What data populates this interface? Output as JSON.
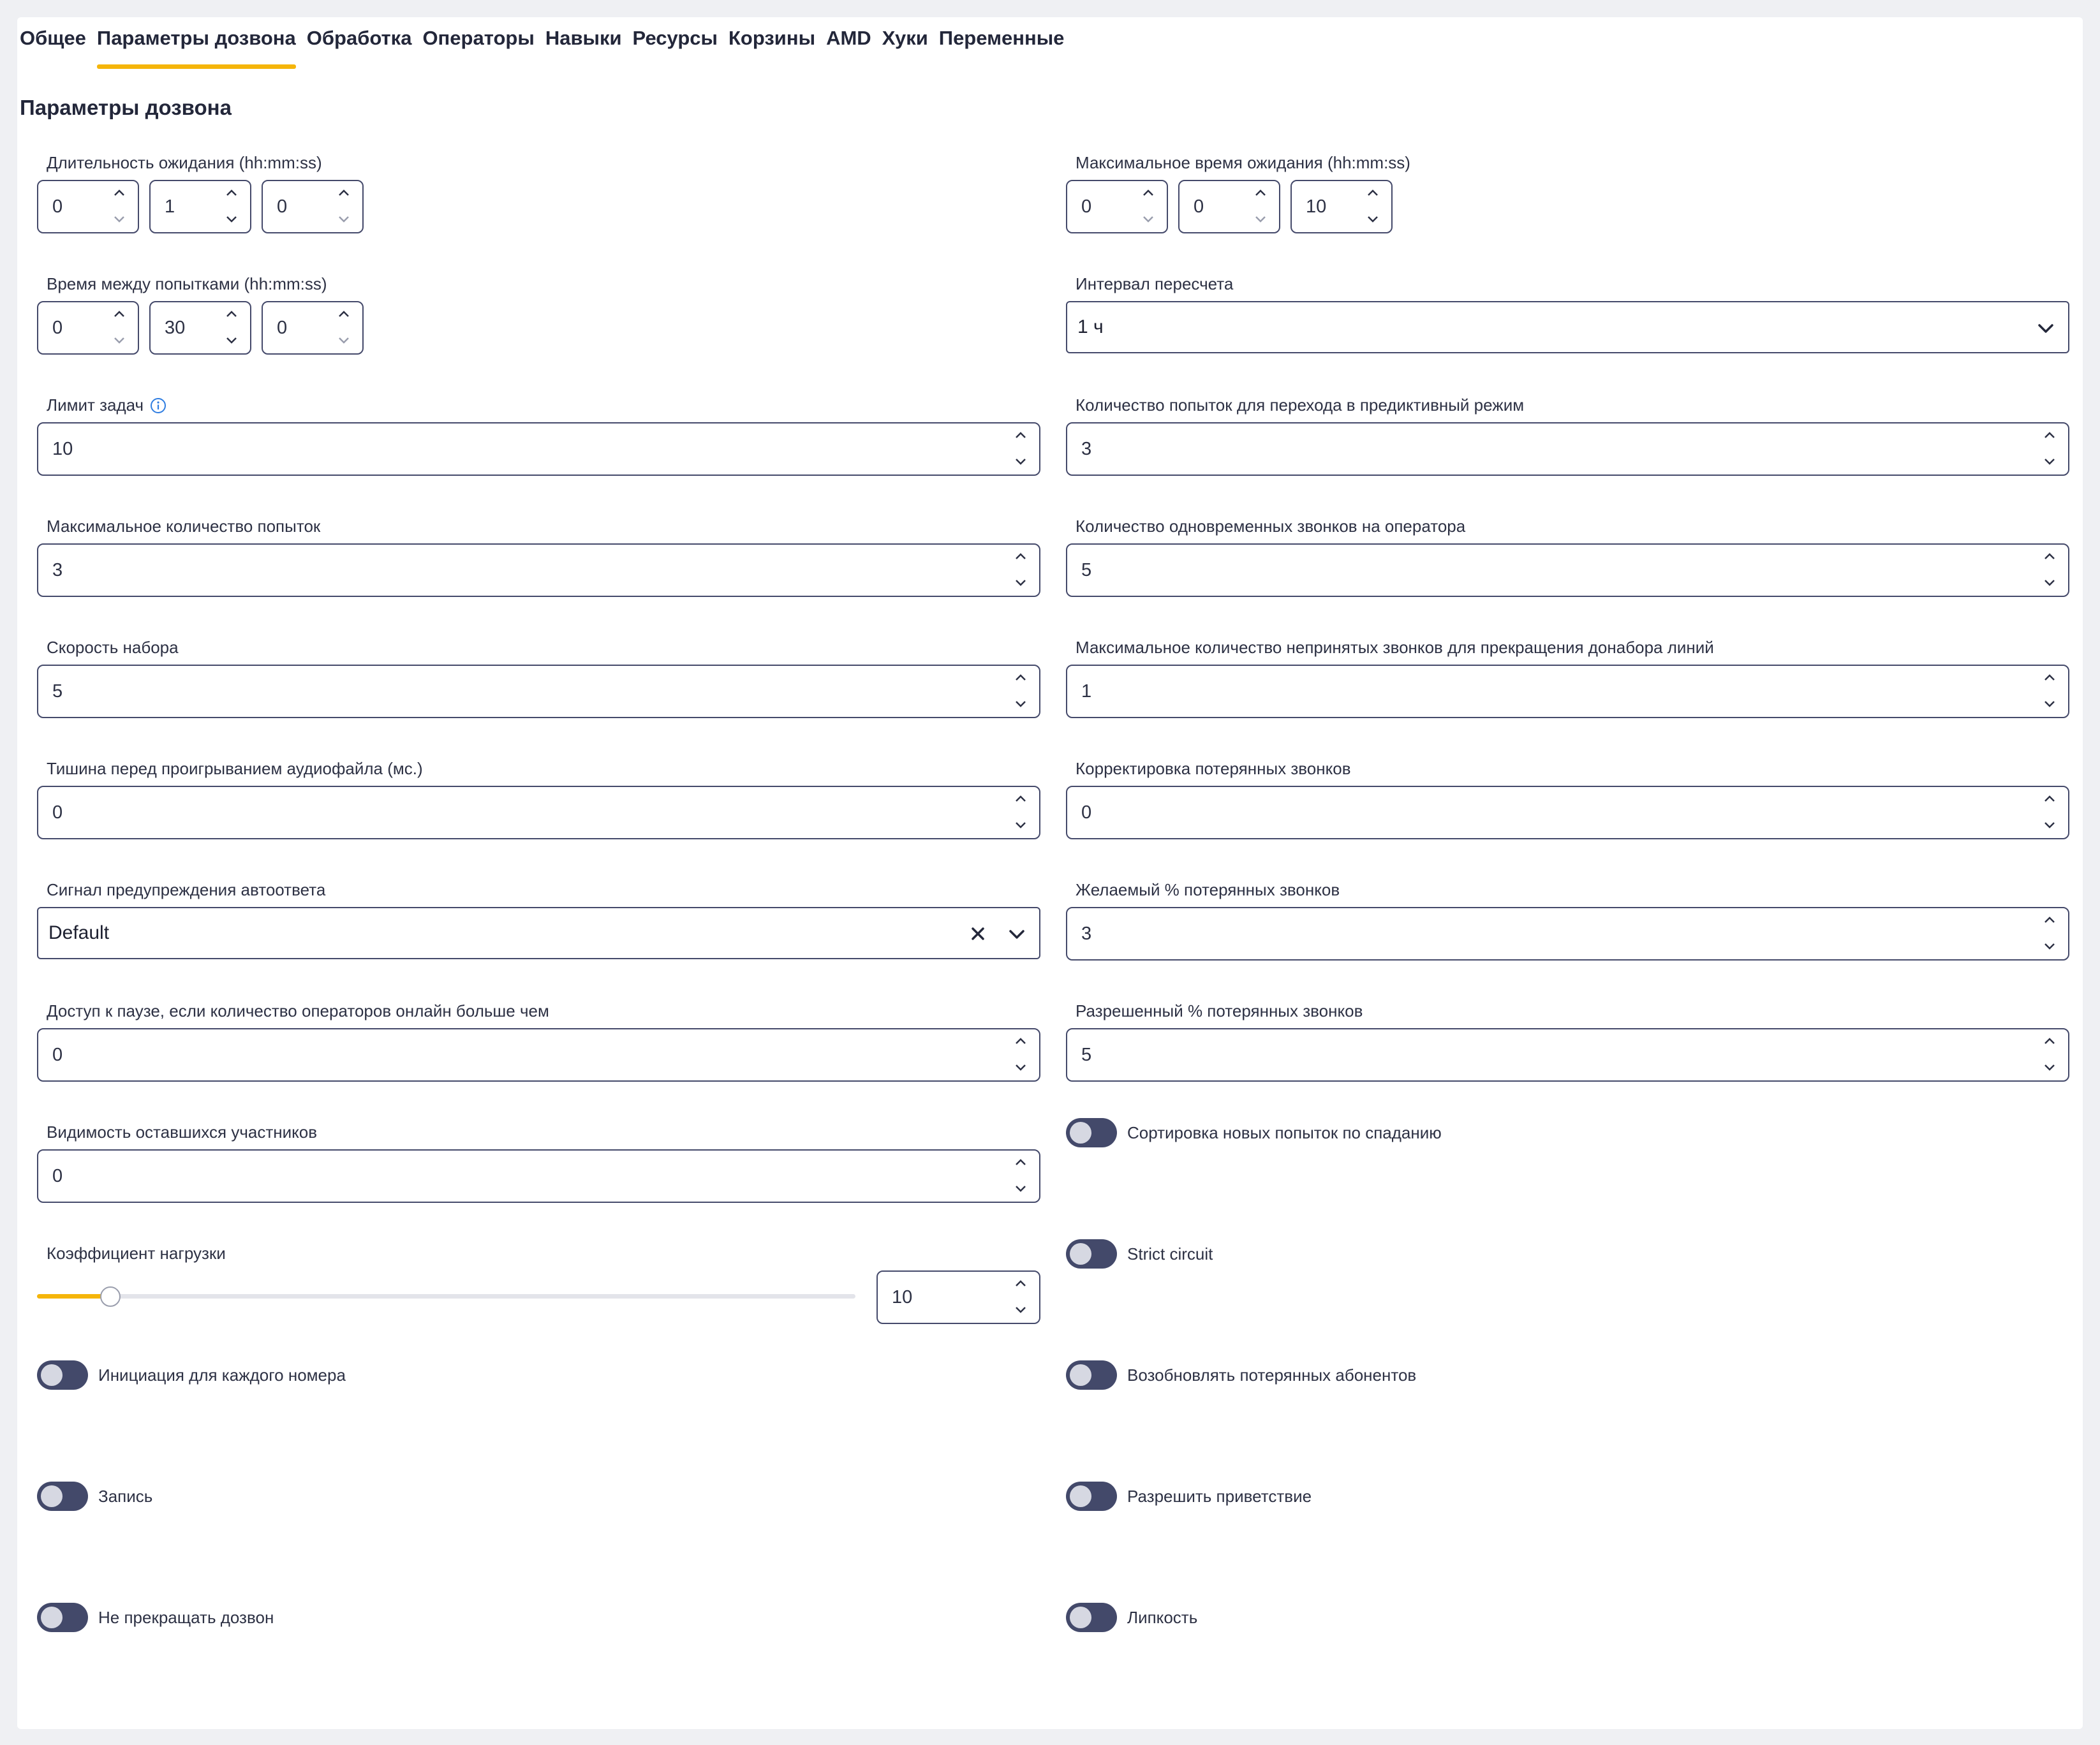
{
  "tabs": [
    {
      "label": "Общее",
      "active": false
    },
    {
      "label": "Параметры дозвона",
      "active": true
    },
    {
      "label": "Обработка",
      "active": false
    },
    {
      "label": "Операторы",
      "active": false
    },
    {
      "label": "Навыки",
      "active": false
    },
    {
      "label": "Ресурсы",
      "active": false
    },
    {
      "label": "Корзины",
      "active": false
    },
    {
      "label": "AMD",
      "active": false
    },
    {
      "label": "Хуки",
      "active": false
    },
    {
      "label": "Переменные",
      "active": false
    }
  ],
  "section_title": "Параметры дозвона",
  "fields": {
    "wait_duration": {
      "label": "Длительность ожидания (hh:mm:ss)",
      "h": "0",
      "m": "1",
      "s": "0"
    },
    "max_wait": {
      "label": "Максимальное время ожидания (hh:mm:ss)",
      "h": "0",
      "m": "0",
      "s": "10"
    },
    "retry_interval": {
      "label": "Время между попытками (hh:mm:ss)",
      "h": "0",
      "m": "30",
      "s": "0"
    },
    "recalc_interval": {
      "label": "Интервал пересчета",
      "value": "1 ч"
    },
    "task_limit": {
      "label": "Лимит задач",
      "value": "10"
    },
    "predictive_attempts": {
      "label": "Количество попыток для перехода в предиктивный режим",
      "value": "3"
    },
    "max_attempts": {
      "label": "Максимальное количество попыток",
      "value": "3"
    },
    "concurrent_calls": {
      "label": "Количество одновременных звонков на оператора",
      "value": "5"
    },
    "dial_speed": {
      "label": "Скорость набора",
      "value": "5"
    },
    "max_unanswered": {
      "label": "Максимальное количество непринятых звонков для прекращения донабора линий",
      "value": "1"
    },
    "silence": {
      "label": "Тишина перед проигрыванием аудиофайла (мс.)",
      "value": "0"
    },
    "lost_correction": {
      "label": "Корректировка потерянных звонков",
      "value": "0"
    },
    "autoanswer_signal": {
      "label": "Сигнал предупреждения автоответа",
      "value": "Default"
    },
    "desired_lost": {
      "label": "Желаемый % потерянных звонков",
      "value": "3"
    },
    "pause_access": {
      "label": "Доступ к паузе, если количество операторов онлайн больше чем",
      "value": "0"
    },
    "allowed_lost": {
      "label": "Разрешенный % потерянных звонков",
      "value": "5"
    },
    "remaining_visibility": {
      "label": "Видимость оставшихся участников",
      "value": "0"
    },
    "load_factor": {
      "label": "Коэффициент нагрузки",
      "value": "10",
      "slider_fraction": 0.09
    }
  },
  "toggles": {
    "sort_desc": {
      "label": "Сортировка новых попыток по спаданию",
      "on": false
    },
    "strict_circuit": {
      "label": "Strict circuit",
      "on": false
    },
    "init_each": {
      "label": "Инициация для каждого номера",
      "on": false
    },
    "resume_lost": {
      "label": "Возобновлять потерянных абонентов",
      "on": false
    },
    "record": {
      "label": "Запись",
      "on": false
    },
    "allow_greeting": {
      "label": "Разрешить приветствие",
      "on": false
    },
    "no_stop": {
      "label": "Не прекращать дозвон",
      "on": false
    },
    "stickiness": {
      "label": "Липкость",
      "on": false
    }
  },
  "colors": {
    "accent": "#f5b50a",
    "border": "#44496a",
    "toggle_off": "#43496a",
    "info": "#2f7de1"
  }
}
